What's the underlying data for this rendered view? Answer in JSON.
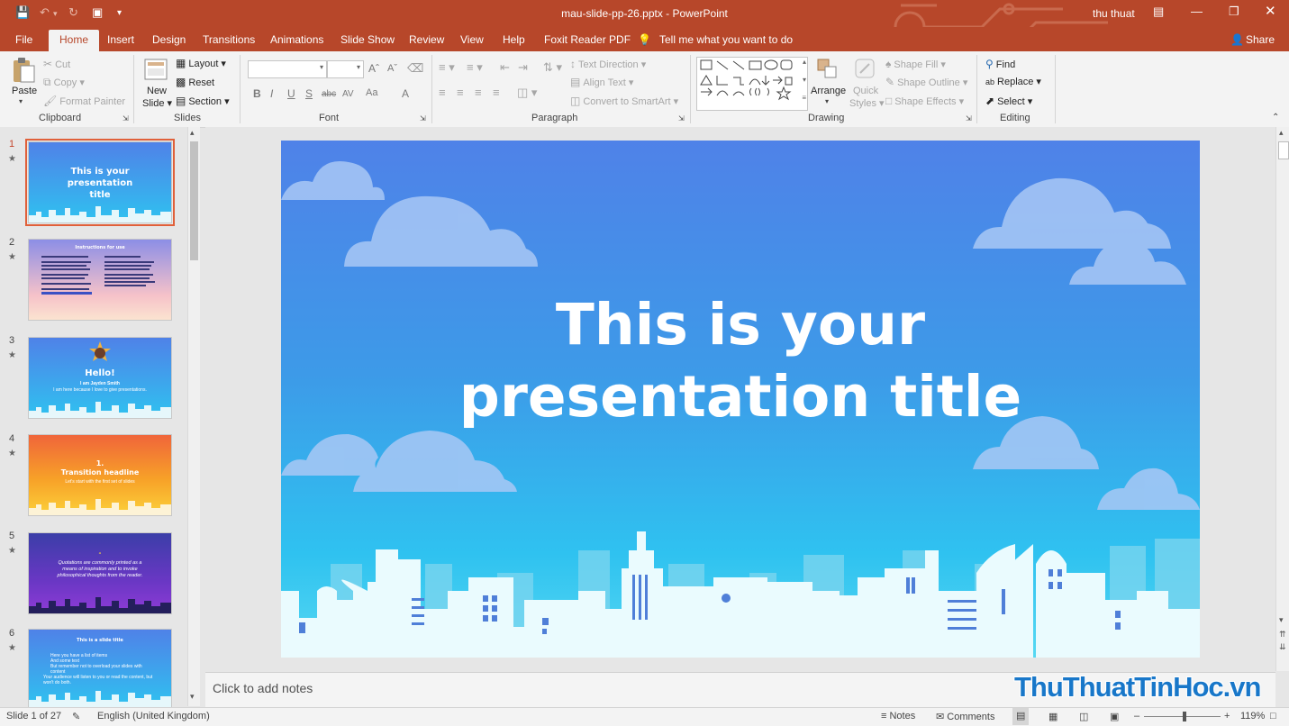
{
  "window": {
    "title": "mau-slide-pp-26.pptx  -  PowerPoint",
    "user": "thu thuat",
    "accent": "#b7472a"
  },
  "ribbon_tabs": [
    "File",
    "Home",
    "Insert",
    "Design",
    "Transitions",
    "Animations",
    "Slide Show",
    "Review",
    "View",
    "Help",
    "Foxit Reader PDF"
  ],
  "tell_me": "Tell me what you want to do",
  "share": "Share",
  "clipboard": {
    "paste": "Paste",
    "cut": "Cut",
    "copy": "Copy",
    "format_painter": "Format Painter",
    "label": "Clipboard"
  },
  "slides_group": {
    "new_slide_1": "New",
    "new_slide_2": "Slide",
    "layout": "Layout",
    "reset": "Reset",
    "section": "Section",
    "label": "Slides"
  },
  "font_group": {
    "label": "Font",
    "buttons": [
      "B",
      "I",
      "U",
      "S",
      "abc",
      "AV",
      "Aa",
      "A"
    ]
  },
  "paragraph_group": {
    "label": "Paragraph",
    "text_direction": "Text Direction",
    "align_text": "Align Text",
    "convert_smartart": "Convert to SmartArt"
  },
  "drawing_group": {
    "label": "Drawing",
    "arrange": "Arrange",
    "quick_styles_1": "Quick",
    "quick_styles_2": "Styles",
    "shape_fill": "Shape Fill",
    "shape_outline": "Shape Outline",
    "shape_effects": "Shape Effects"
  },
  "editing_group": {
    "label": "Editing",
    "find": "Find",
    "replace": "Replace",
    "select": "Select"
  },
  "thumbnails": [
    {
      "num": "1",
      "title": "This is your presentation title"
    },
    {
      "num": "2",
      "title": "Instructions for use"
    },
    {
      "num": "3",
      "title": "Hello!",
      "sub": "I am Jayden Smith",
      "sub2": "I am here because I love to give presentations."
    },
    {
      "num": "4",
      "title": "1.",
      "sub": "Transition headline",
      "sub2": "Let's start with the first set of slides"
    },
    {
      "num": "5",
      "quote": "Quotations are commonly printed as a means of inspiration and to invoke philosophical thoughts from the reader."
    },
    {
      "num": "6",
      "title": "This is a slide title",
      "bullets": [
        "Here you have a list of items",
        "And some text",
        "But remember not to overload your slides with content"
      ],
      "foot": "Your audience will listen to you or read the content, but won't do both."
    }
  ],
  "slide": {
    "title_line1": "This is your",
    "title_line2": "presentation title"
  },
  "notes_placeholder": "Click to add notes",
  "status": {
    "slide_info": "Slide 1 of 27",
    "language": "English (United Kingdom)",
    "notes": "Notes",
    "comments": "Comments",
    "zoom": "119%"
  },
  "watermark": "ThuThuatTinHoc.vn"
}
